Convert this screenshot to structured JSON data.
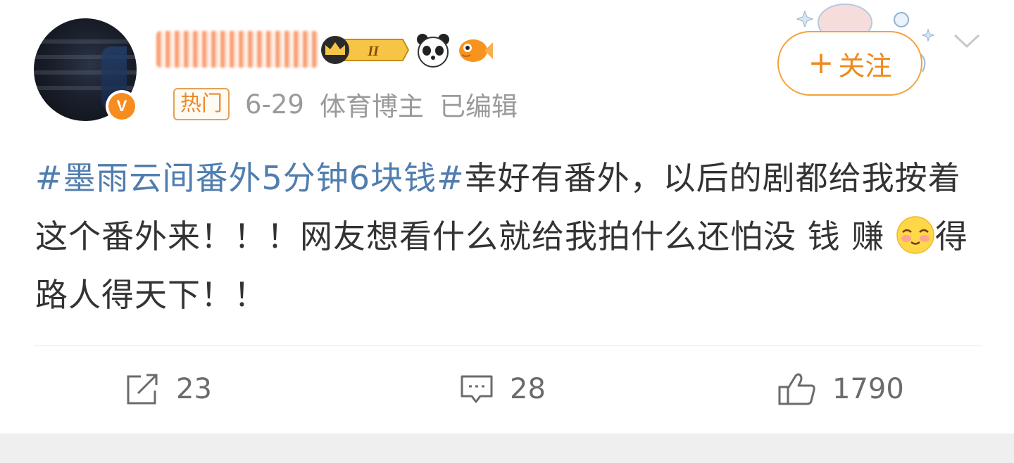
{
  "post": {
    "meta": {
      "hot_tag": "热门",
      "date": "6-29",
      "author_type": "体育博主",
      "edited": "已编辑"
    },
    "follow_label": "关注",
    "verified_badge": "V",
    "level_badge": "II",
    "content": {
      "hashtag": "#墨雨云间番外5分钟6块钱#",
      "line_text": "幸好有番外，以后的剧都给我按着这个番外来！！！网友想看什么就给我拍什么还怕没 钱 赚 ",
      "emoji_name": "blushing-face-emoji",
      "tail_text": "得路人得天下！！"
    },
    "actions": {
      "repost_count": "23",
      "comment_count": "28",
      "like_count": "1790"
    }
  },
  "colors": {
    "hashtag": "#507daf",
    "accent_orange": "#ee8a1d",
    "meta_gray": "#9a9a9a"
  }
}
